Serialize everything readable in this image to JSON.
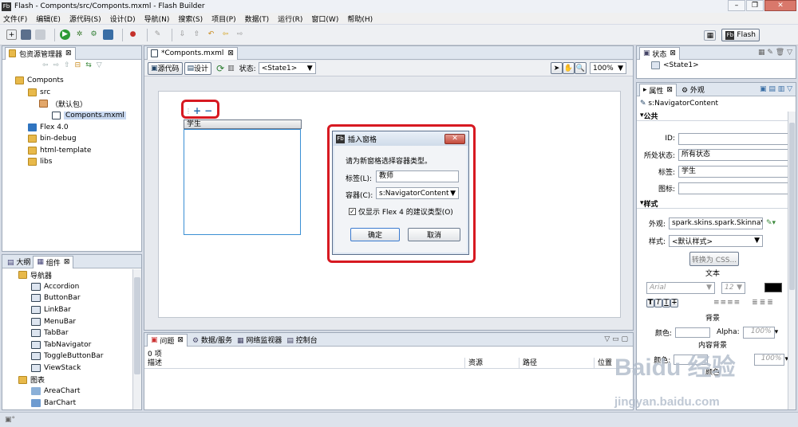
{
  "window": {
    "title": "Flash - Componts/src/Componts.mxml - Flash Builder",
    "app_badge": "Fb"
  },
  "menu": [
    "文件(F)",
    "编辑(E)",
    "源代码(S)",
    "设计(D)",
    "导航(N)",
    "搜索(S)",
    "项目(P)",
    "数据(T)",
    "运行(R)",
    "窗口(W)",
    "帮助(H)"
  ],
  "perspective": {
    "badge": "Fb",
    "label": "Flash"
  },
  "package_explorer": {
    "tab": "包资源管理器",
    "items": [
      {
        "label": "Componts",
        "indent": 0,
        "icon": "project-folder-icon"
      },
      {
        "label": "src",
        "indent": 1,
        "icon": "source-folder-icon"
      },
      {
        "label": "（默认包）",
        "indent": 2,
        "icon": "package-icon"
      },
      {
        "label": "Componts.mxml",
        "indent": 3,
        "icon": "mxml-file-icon",
        "selected": true
      },
      {
        "label": "Flex 4.0",
        "indent": 1,
        "icon": "library-icon"
      },
      {
        "label": "bin-debug",
        "indent": 1,
        "icon": "folder-icon"
      },
      {
        "label": "html-template",
        "indent": 1,
        "icon": "folder-icon"
      },
      {
        "label": "libs",
        "indent": 1,
        "icon": "folder-icon"
      }
    ]
  },
  "components_panel": {
    "tabs": [
      "大纲",
      "组件"
    ],
    "categories": [
      {
        "label": "导航器",
        "items": [
          "Accordion",
          "ButtonBar",
          "LinkBar",
          "MenuBar",
          "TabBar",
          "TabNavigator",
          "ToggleButtonBar",
          "ViewStack"
        ]
      },
      {
        "label": "图表",
        "items": [
          "AreaChart",
          "BarChart"
        ]
      }
    ]
  },
  "editor": {
    "tab": "*Componts.mxml",
    "mode_source": "源代码",
    "mode_design": "设计",
    "state_label": "状态:",
    "state_value": "<State1>",
    "zoom": "100%",
    "nav_header": "学生"
  },
  "dialog": {
    "title": "插入窗格",
    "badge": "Fb",
    "prompt": "请为新窗格选择容器类型。",
    "label_caption": "标签(L):",
    "label_value": "教师",
    "container_caption": "容器(C):",
    "container_value": "s:NavigatorContent",
    "checkbox_label": "仅显示 Flex 4 的建议类型(O)",
    "checkbox_checked": true,
    "ok": "确定",
    "cancel": "取消"
  },
  "problems_panel": {
    "tabs": [
      "问题",
      "数据/服务",
      "网络监视器",
      "控制台"
    ],
    "count": "0 项",
    "columns": [
      "描述",
      "资源",
      "路径",
      "位置"
    ]
  },
  "states_panel": {
    "tab": "状态",
    "items": [
      "<State1>"
    ]
  },
  "properties_panel": {
    "tabs": [
      "属性",
      "外观"
    ],
    "component": "s:NavigatorContent",
    "common": {
      "header": "公共",
      "id_label": "ID:",
      "id_value": "",
      "state_label": "所处状态:",
      "state_value": "所有状态",
      "label_label": "标签:",
      "label_value": "学生",
      "icon_label": "图标:",
      "icon_value": ""
    },
    "style": {
      "header": "样式",
      "skin_label": "外观:",
      "skin_value": "spark.skins.spark.Skinna",
      "style_label": "样式:",
      "style_value": "<默认样式>",
      "convert_css": "转换为 CSS...",
      "text_header": "文本",
      "font_value": "Arial",
      "font_size": "12",
      "format_buttons": [
        "T",
        "T",
        "T",
        "T"
      ],
      "text_color": "#000000",
      "bg_header": "背景",
      "bg_color_label": "颜色:",
      "alpha_label": "Alpha:",
      "alpha_value": "100%",
      "content_bg_header": "内容背景",
      "content_color_label": "颜色:",
      "content_alpha_value": "100%",
      "color_header": "颜色"
    }
  },
  "watermark": {
    "brand": "Baidu 经验",
    "url": "jingyan.baidu.com"
  }
}
